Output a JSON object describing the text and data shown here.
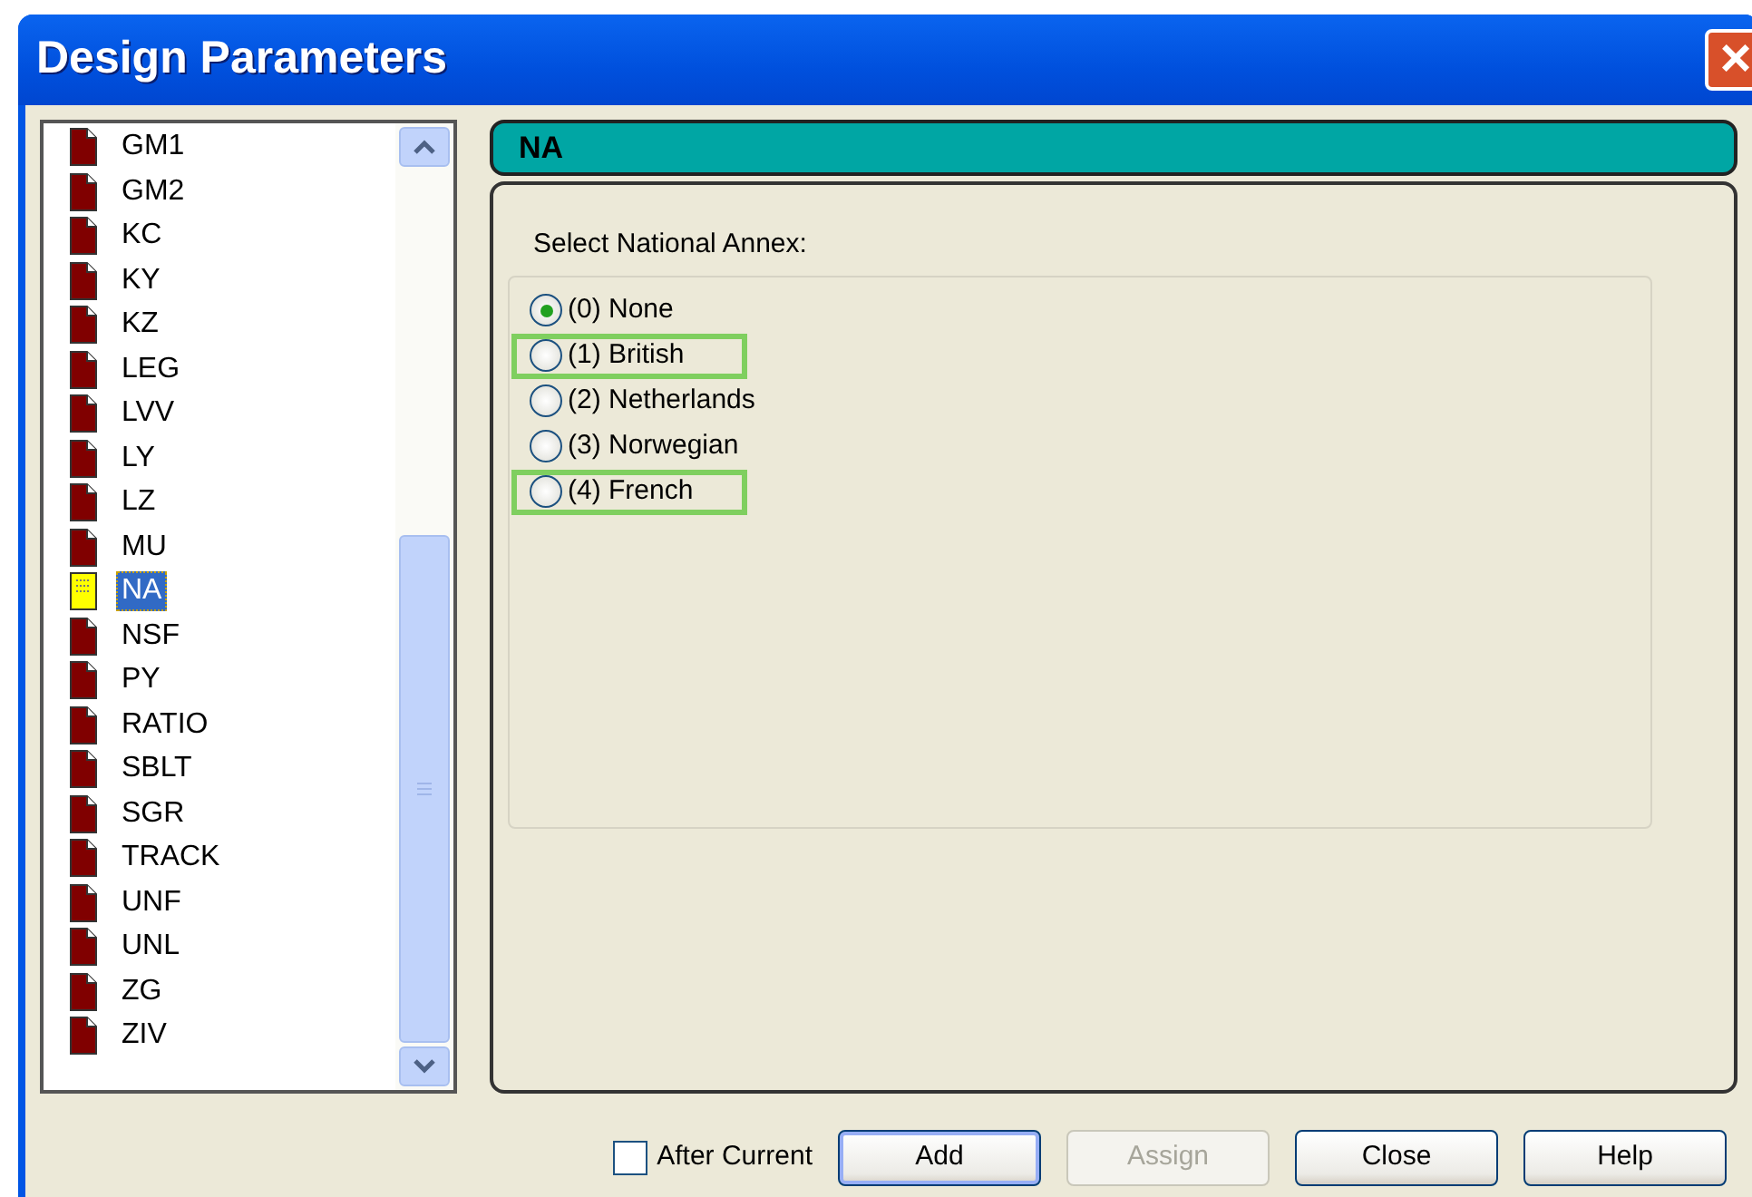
{
  "window": {
    "title": "Design Parameters",
    "close": "×"
  },
  "parameters": [
    {
      "label": "GM1",
      "selected": false
    },
    {
      "label": "GM2",
      "selected": false
    },
    {
      "label": "KC",
      "selected": false
    },
    {
      "label": "KY",
      "selected": false
    },
    {
      "label": "KZ",
      "selected": false
    },
    {
      "label": "LEG",
      "selected": false
    },
    {
      "label": "LVV",
      "selected": false
    },
    {
      "label": "LY",
      "selected": false
    },
    {
      "label": "LZ",
      "selected": false
    },
    {
      "label": "MU",
      "selected": false
    },
    {
      "label": "NA",
      "selected": true
    },
    {
      "label": "NSF",
      "selected": false
    },
    {
      "label": "PY",
      "selected": false
    },
    {
      "label": "RATIO",
      "selected": false
    },
    {
      "label": "SBLT",
      "selected": false
    },
    {
      "label": "SGR",
      "selected": false
    },
    {
      "label": "TRACK",
      "selected": false
    },
    {
      "label": "UNF",
      "selected": false
    },
    {
      "label": "UNL",
      "selected": false
    },
    {
      "label": "ZG",
      "selected": false
    },
    {
      "label": "ZIV",
      "selected": false
    }
  ],
  "panel": {
    "header": "NA",
    "prompt": "Select National Annex:",
    "options": [
      {
        "label": "(0) None",
        "selected": true,
        "highlighted": false
      },
      {
        "label": "(1)  British",
        "selected": false,
        "highlighted": true
      },
      {
        "label": "(2)  Netherlands",
        "selected": false,
        "highlighted": false
      },
      {
        "label": "(3)  Norwegian",
        "selected": false,
        "highlighted": false
      },
      {
        "label": "(4)  French",
        "selected": false,
        "highlighted": true
      }
    ]
  },
  "after_current": {
    "label": "After Current",
    "checked": false
  },
  "buttons": [
    {
      "label": "Add",
      "default": true,
      "disabled": false
    },
    {
      "label": "Assign",
      "default": false,
      "disabled": true
    },
    {
      "label": "Close",
      "default": false,
      "disabled": false
    },
    {
      "label": "Help",
      "default": false,
      "disabled": false
    }
  ]
}
